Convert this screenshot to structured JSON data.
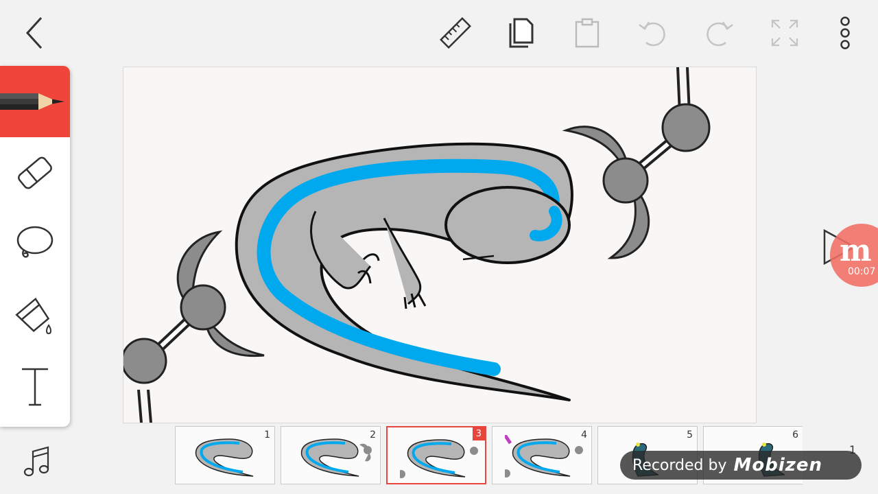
{
  "toolbar": {
    "back_icon": "chevron-left-icon",
    "ruler_icon": "ruler-icon",
    "copy_icon": "copy-icon",
    "paste_icon": "paste-icon",
    "undo_icon": "undo-icon",
    "redo_icon": "redo-icon",
    "fullscreen_icon": "fullscreen-icon",
    "more_icon": "more-vertical-icon"
  },
  "tools": [
    "pencil",
    "eraser",
    "lasso",
    "fill",
    "text"
  ],
  "active_tool": "pencil",
  "colors": {
    "accent": "#f0453a",
    "body_gray": "#b5b5b5",
    "stripe_blue": "#00a8ee",
    "blade_gray": "#8c8c8c"
  },
  "frames": [
    {
      "number": "1",
      "selected": false
    },
    {
      "number": "2",
      "selected": false
    },
    {
      "number": "3",
      "selected": true
    },
    {
      "number": "4",
      "selected": false
    },
    {
      "number": "5",
      "selected": false
    },
    {
      "number": "6",
      "selected": false
    }
  ],
  "recorder": {
    "time": "00:07",
    "label": "Recorded by",
    "brand": "Mobizen",
    "logo_letter": "m"
  },
  "frame_count": "1"
}
